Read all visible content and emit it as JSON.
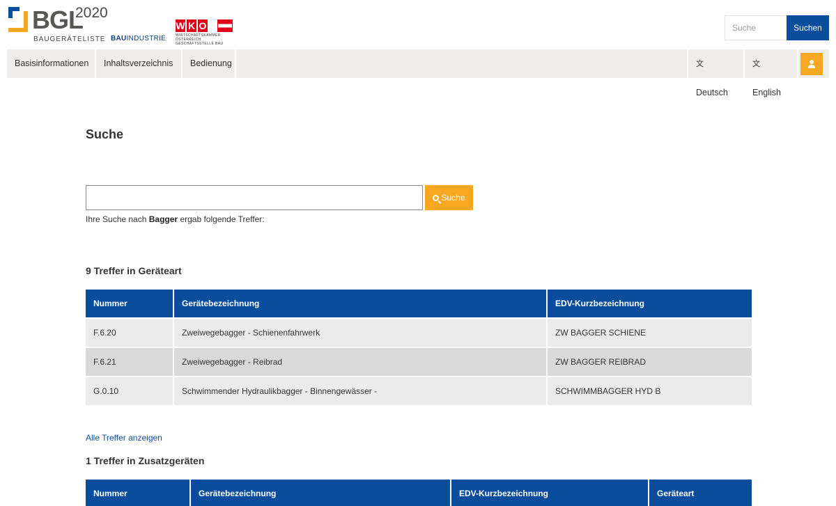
{
  "header": {
    "logo_text": "BGL",
    "logo_year": "2020",
    "logo_subtitle": "BAUGERÄTELISTE",
    "partner_bau_bold": "BAU",
    "partner_bau_rest": "INDUSTRIE",
    "partner_wko_letters": [
      "W",
      "K",
      "O"
    ],
    "partner_wko_subtitle": "WIRTSCHAFTSKAMMER ÖSTERREICH GESCHÄFTSSTELLE BAU",
    "search_placeholder": "Suche",
    "search_button": "Suchen"
  },
  "nav": {
    "items": [
      "Basisinformationen",
      "Inhaltsverzeichnis",
      "Bedienung"
    ],
    "lang_de": "Deutsch",
    "lang_en": "English",
    "user_icon": "user-icon"
  },
  "main": {
    "title": "Suche",
    "search_value": "",
    "search_button": "Suche",
    "result_prefix": "Ihre Suche nach",
    "result_term": "Bagger",
    "result_suffix": "ergab folgende Treffer:",
    "section1": {
      "title": "9 Treffer in Geräteart",
      "headers": [
        "Nummer",
        "Gerätebezeichnung",
        "EDV-Kurzbezeichnung"
      ],
      "rows": [
        [
          "F.6.20",
          "Zweiwegebagger - Schienenfahrwerk",
          "ZW BAGGER SCHIENE"
        ],
        [
          "F.6.21",
          "Zweiwegebagger - Reibrad",
          "ZW BAGGER REIBRAD"
        ],
        [
          "G.0.10",
          "Schwimmender Hydraulikbagger - Binnengewässer -",
          "SCHWIMMBAGGER HYD B"
        ]
      ],
      "all_link": "Alle Treffer anzeigen"
    },
    "section2": {
      "title": "1 Treffer in Zusatzgeräten",
      "headers": [
        "Nummer",
        "Gerätebezeichnung",
        "EDV-Kurzbezeichnung",
        "Geräteart"
      ]
    }
  },
  "colors": {
    "primary_blue": "#0b4d9d",
    "accent_orange": "#f6a823",
    "nav_bg": "#eeedea"
  }
}
